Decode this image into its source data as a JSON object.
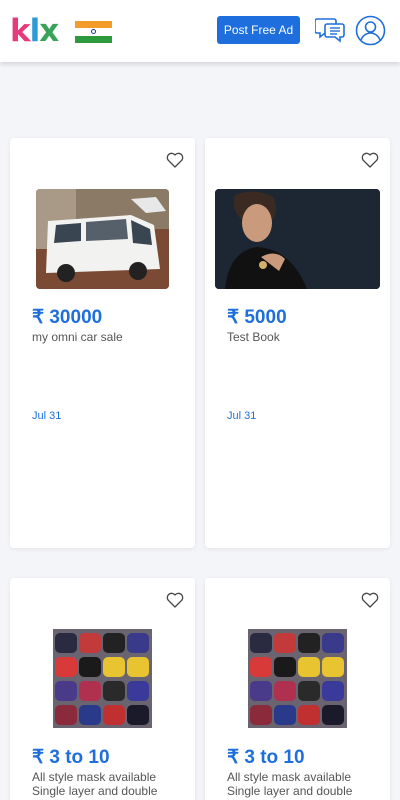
{
  "header": {
    "logo": {
      "k": "k",
      "l": "l",
      "x": "x"
    },
    "flag_icon": "india-flag-icon",
    "post_button_label": "Post Free Ad",
    "chat_icon": "chat-icon",
    "profile_icon": "user-profile-icon"
  },
  "colors": {
    "accent": "#1e6fdd",
    "logo_k": "#e63b7a",
    "logo_l": "#2c9bd6",
    "logo_x": "#3aa35a"
  },
  "listings": [
    {
      "price": "₹ 30000",
      "title": "my omni car sale",
      "date": "Jul 31",
      "icon": "heart-icon"
    },
    {
      "price": "₹ 5000",
      "title": "Test Book",
      "date": "Jul 31",
      "icon": "heart-icon"
    },
    {
      "price": "₹ 3 to 10",
      "title": "All style mask available Single layer and double",
      "icon": "heart-icon"
    },
    {
      "price": "₹ 3 to 10",
      "title": "All style mask available Single layer and double",
      "icon": "heart-icon"
    }
  ]
}
